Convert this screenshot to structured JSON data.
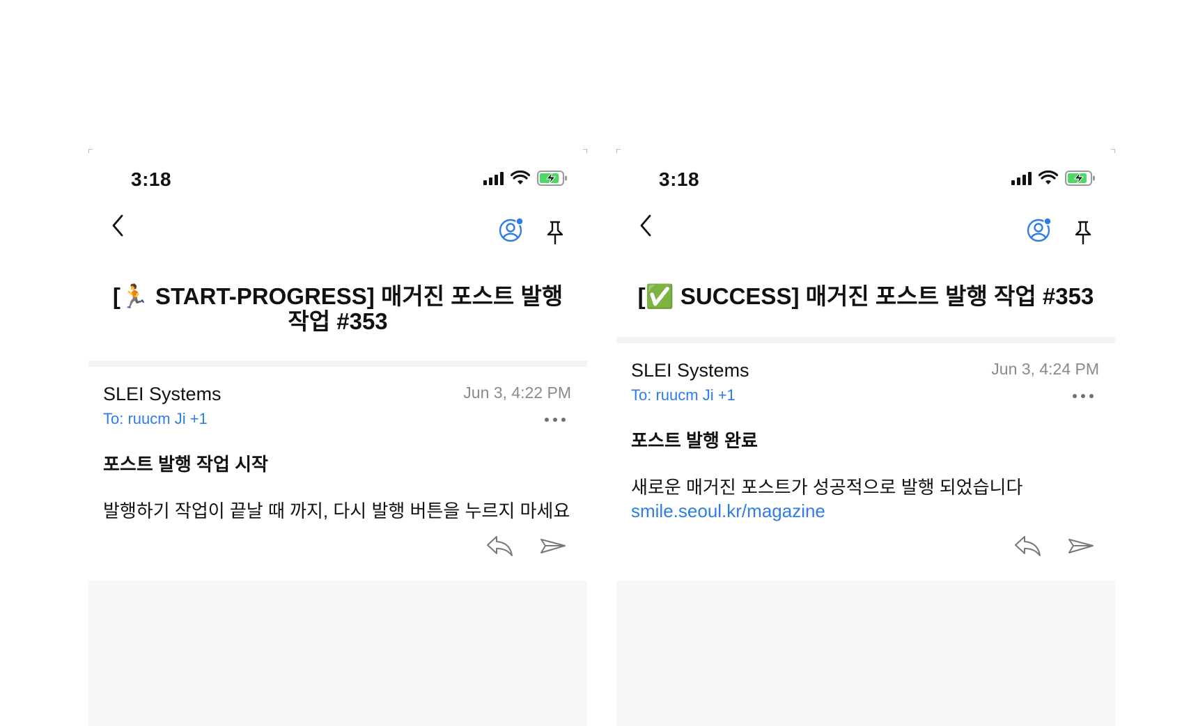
{
  "screens": [
    {
      "status": {
        "time": "3:18"
      },
      "subject": "[🏃 START-PROGRESS] 매거진 포스트 발행 작업 #353",
      "email": {
        "sender": "SLEI Systems",
        "date": "Jun 3, 4:22 PM",
        "recipients": "To: ruucm Ji +1",
        "heading": "포스트 발행 작업 시작",
        "body": "발행하기 작업이 끝날 때 까지, 다시 발행 버튼을 누르지 마세요",
        "link": ""
      }
    },
    {
      "status": {
        "time": "3:18"
      },
      "subject": "[✅ SUCCESS] 매거진 포스트 발행 작업 #353",
      "email": {
        "sender": "SLEI Systems",
        "date": "Jun 3, 4:24 PM",
        "recipients": "To: ruucm Ji +1",
        "heading": "포스트 발행 완료",
        "body": "새로운 매거진 포스트가 성공적으로 발행 되었습니다",
        "link": "smile.seoul.kr/magazine"
      }
    }
  ],
  "icons": {
    "back": "chevron-left-icon",
    "account": "account-circle-icon",
    "pin": "pin-icon",
    "reply": "reply-icon",
    "forward": "forward-icon",
    "more": "more-horizontal-icon"
  },
  "colors": {
    "accent": "#2f7ce6",
    "battery": "#4cd964",
    "divider": "#f1f3f6",
    "secondary_text": "#8a8a8a"
  }
}
